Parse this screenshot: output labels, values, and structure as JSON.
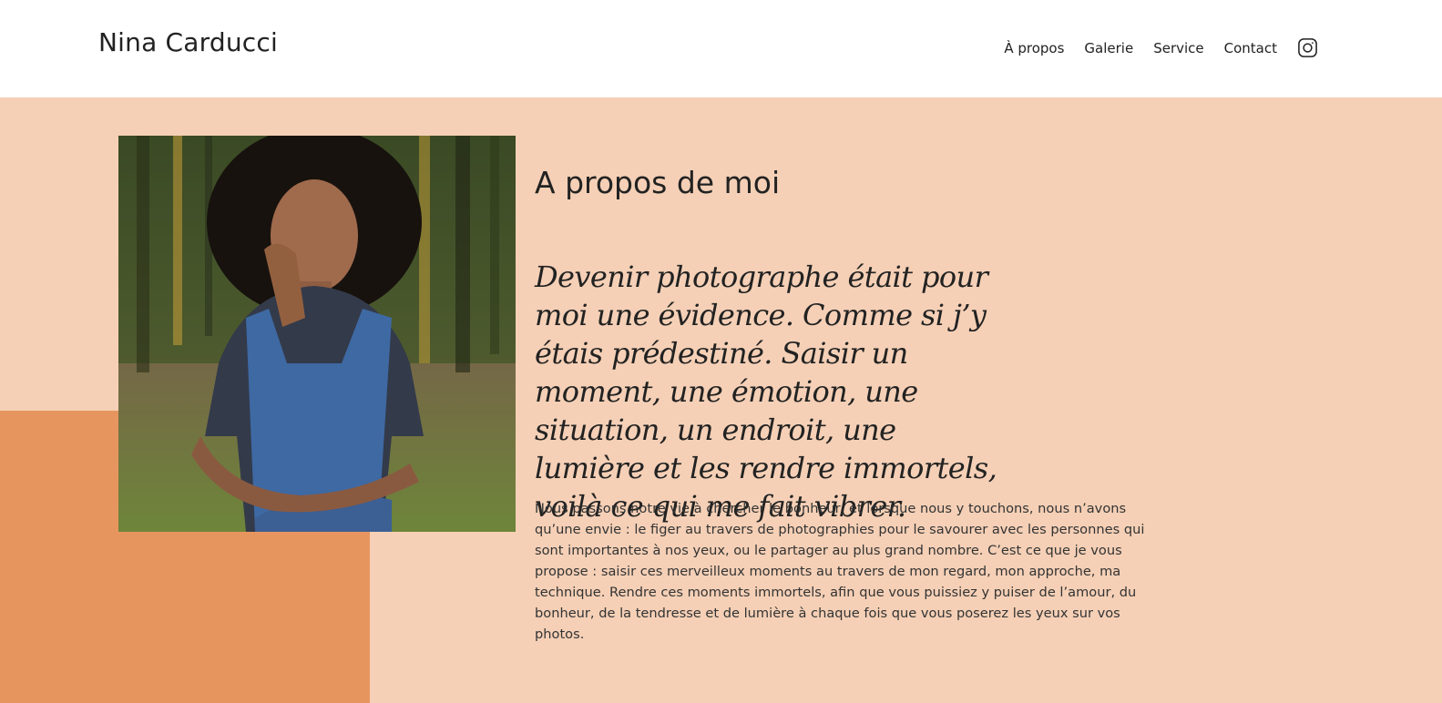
{
  "header": {
    "brand": "Nina Carducci",
    "nav": [
      {
        "label": "À propos"
      },
      {
        "label": "Galerie"
      },
      {
        "label": "Service"
      },
      {
        "label": "Contact"
      }
    ],
    "social_icon": "instagram-icon"
  },
  "about": {
    "title": "A propos de moi",
    "quote": "Devenir photographe était pour moi une évidence. Comme si j’y étais prédestiné. Saisir un moment, une émotion, une situation, un endroit, une lumière et les rendre immortels, voilà ce qui me fait vibrer.",
    "body": "Nous passons notre vie à chercher le bonheur, et lorsque nous y touchons, nous n’avons qu’une envie : le figer au travers de photographies pour le savourer avec les personnes qui sont importantes à nos yeux, ou le partager au plus grand nombre. C’est ce que je vous propose : saisir ces merveilleux moments au travers de mon regard, mon approche, ma technique. Rendre ces moments immortels, afin que vous puissiez y puiser de l’amour, du bonheur, de la tendresse et de lumière à chaque fois que vous poserez les yeux sur vos photos."
  },
  "colors": {
    "header_bg": "#ffffff",
    "section_bg": "#f5d0b6",
    "accent_block": "#e7955e",
    "text": "#222222"
  }
}
